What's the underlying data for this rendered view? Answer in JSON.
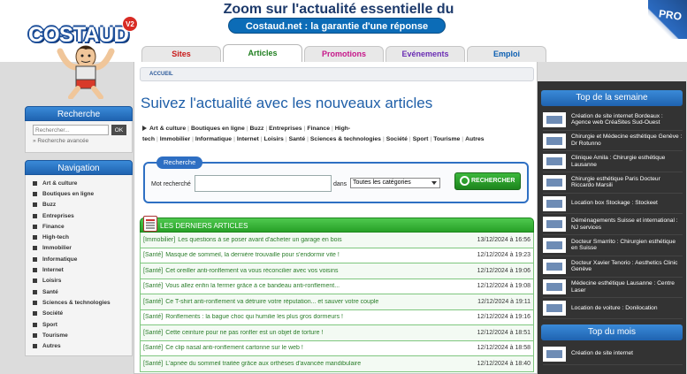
{
  "header": {
    "logo_text": "COSTAUD",
    "logo_badge": "V2",
    "tagline": "Zoom sur l'actualité essentielle du web",
    "subline": "Costaud.net : la garantie d'une réponse pertinente !",
    "pro_label": "PRO"
  },
  "tabs": [
    {
      "label": "Sites"
    },
    {
      "label": "Articles"
    },
    {
      "label": "Promotions"
    },
    {
      "label": "Evénements"
    },
    {
      "label": "Emploi"
    }
  ],
  "sidebar": {
    "search_title": "Recherche",
    "search_placeholder": "Rechercher...",
    "ok_label": "OK",
    "advanced_link": "» Recherche avancée",
    "nav_title": "Navigation",
    "nav_items": [
      {
        "label": "Art & culture"
      },
      {
        "label": "Boutiques en ligne"
      },
      {
        "label": "Buzz"
      },
      {
        "label": "Entreprises"
      },
      {
        "label": "Finance"
      },
      {
        "label": "High-tech"
      },
      {
        "label": "Immobilier"
      },
      {
        "label": "Informatique"
      },
      {
        "label": "Internet"
      },
      {
        "label": "Loisirs"
      },
      {
        "label": "Santé"
      },
      {
        "label": "Sciences & technologies"
      },
      {
        "label": "Société"
      },
      {
        "label": "Sport"
      },
      {
        "label": "Tourisme"
      },
      {
        "label": "Autres"
      }
    ]
  },
  "main": {
    "breadcrumb": "ACCUEIL",
    "title": "Suivez l'actualité avec les nouveaux articles",
    "categories": [
      "Art & culture",
      "Boutiques en ligne",
      "Buzz",
      "Entreprises",
      "Finance",
      "High-tech",
      "Immobilier",
      "Informatique",
      "Internet",
      "Loisirs",
      "Santé",
      "Sciences & technologies",
      "Société",
      "Sport",
      "Tourisme",
      "Autres"
    ],
    "search": {
      "legend": "Recherche",
      "keyword_label": "Mot recherché",
      "in_label": "dans",
      "category_select": "Toutes les catégories",
      "button_label": "RECHERCHER"
    },
    "articles_title": "LES DERNIERS ARTICLES",
    "articles": [
      {
        "cat": "[Immobilier]",
        "title": "Les questions à se poser avant d'acheter un garage en bois",
        "date": "13/12/2024 à 16:56"
      },
      {
        "cat": "[Santé]",
        "title": "Masque de sommeil, la dernière trouvaille pour s'endormir vite !",
        "date": "12/12/2024 à 19:23"
      },
      {
        "cat": "[Santé]",
        "title": "Cet oreiller anti-ronflement va vous réconcilier avec vos voisins",
        "date": "12/12/2024 à 19:06"
      },
      {
        "cat": "[Santé]",
        "title": "Vous allez enfin la fermer grâce à ce bandeau anti-ronflement...",
        "date": "12/12/2024 à 19:08"
      },
      {
        "cat": "[Santé]",
        "title": "Ce T-shirt anti-ronflement va détruire votre réputation... et sauver votre couple",
        "date": "12/12/2024 à 19:11"
      },
      {
        "cat": "[Santé]",
        "title": "Ronflements : la bague choc qui humilie les plus gros dormeurs !",
        "date": "12/12/2024 à 19:16"
      },
      {
        "cat": "[Santé]",
        "title": "Cette ceinture pour ne pas ronfler est un objet de torture !",
        "date": "12/12/2024 à 18:51"
      },
      {
        "cat": "[Santé]",
        "title": "Ce clip nasal anti-ronflement cartonne sur le web !",
        "date": "12/12/2024 à 18:58"
      },
      {
        "cat": "[Santé]",
        "title": "L'apnée du sommeil traitée grâce aux orthèses d'avancée mandibulaire",
        "date": "12/12/2024 à 18:40"
      }
    ]
  },
  "right": {
    "week_title": "Top de la semaine",
    "week_items": [
      {
        "text": "Création de site internet Bordeaux : Agence web CréaSites Sud-Ouest"
      },
      {
        "text": "Chirurgie et Médecine esthétique Genève : Dr Rotunno"
      },
      {
        "text": "Clinique Amila : Chirurgie esthétique Lausanne"
      },
      {
        "text": "Chirurgie esthétique Paris Docteur Riccardo Marsili"
      },
      {
        "text": "Location box Stockage : Stockeet"
      },
      {
        "text": "Déménagements Suisse et international : NJ services"
      },
      {
        "text": "Docteur Smarrito : Chirurgien esthétique en Suisse"
      },
      {
        "text": "Docteur Xavier Tenorio : Aesthetics Clinic Genève"
      },
      {
        "text": "Médecine esthétique Lausanne : Centre Laser"
      },
      {
        "text": "Location de voiture : Donilocation"
      }
    ],
    "month_title": "Top du mois",
    "month_items": [
      {
        "text": "Création de site internet"
      }
    ]
  }
}
